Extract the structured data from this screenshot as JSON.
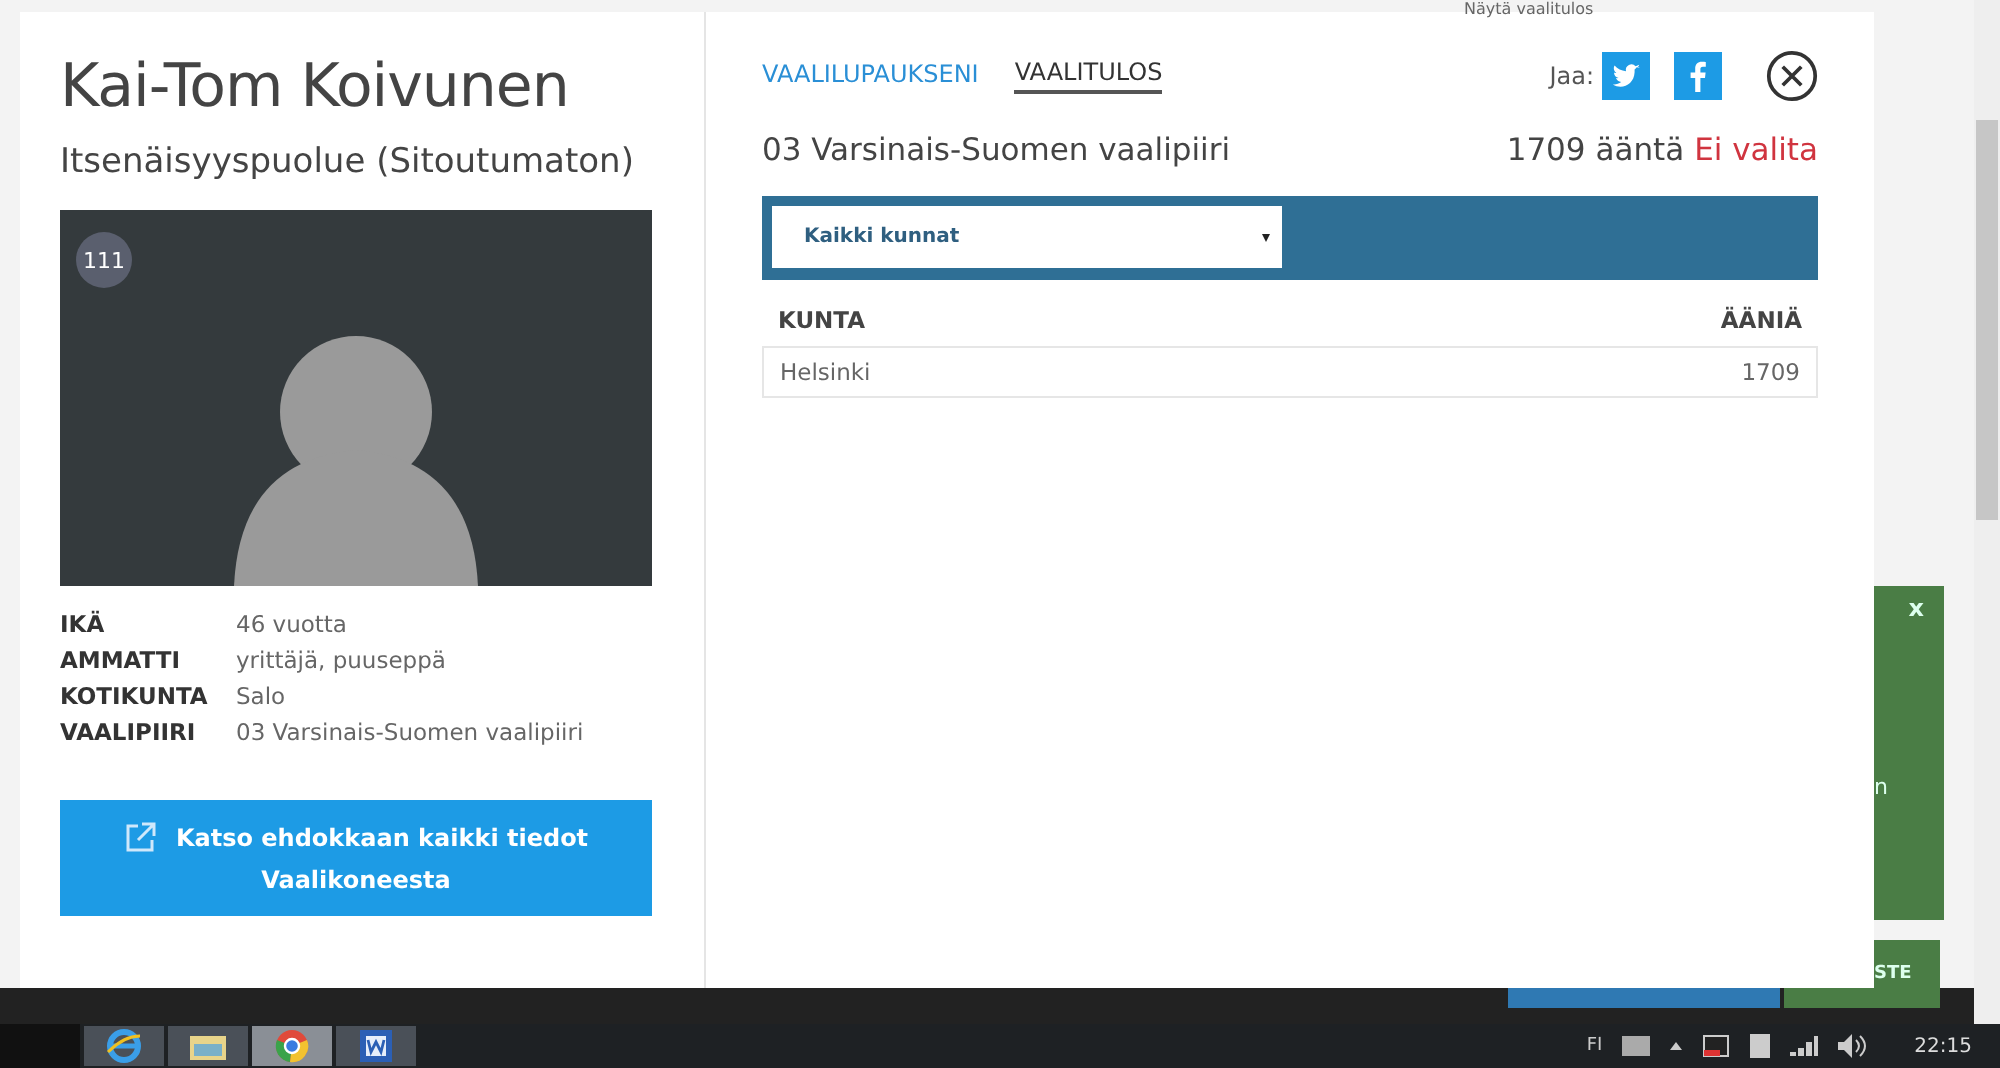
{
  "background_page": {
    "link_text": "Näytä vaalitulos",
    "panel_close": "x",
    "panel_text": "n",
    "panel_button": "STE"
  },
  "candidate": {
    "name": "Kai-Tom Koivunen",
    "party": "Itsenäisyyspuolue (Sitoutumaton)",
    "number": "111",
    "facts": [
      {
        "label": "IKÄ",
        "value": "46 vuotta"
      },
      {
        "label": "AMMATTI",
        "value": "yrittäjä, puuseppä"
      },
      {
        "label": "KOTIKUNTA",
        "value": "Salo"
      },
      {
        "label": "VAALIPIIRI",
        "value": "03 Varsinais-Suomen vaalipiiri"
      }
    ],
    "details_button": [
      "Katso ehdokkaan kaikki tiedot",
      "Vaalikoneesta"
    ]
  },
  "tabs": [
    {
      "label": "VAALILUPAUKSENI",
      "selected": false
    },
    {
      "label": "VAALITULOS",
      "selected": true
    }
  ],
  "share_label": "Jaa:",
  "result": {
    "district": "03 Varsinais-Suomen vaalipiiri",
    "votes": "1709 ääntä",
    "status": "Ei valita",
    "elected": false,
    "filter": {
      "value": "Kaikki kunnat"
    },
    "table": {
      "columns": [
        "KUNTA",
        "ÄÄNIÄ"
      ],
      "rows": [
        [
          "Helsinki",
          "1709"
        ]
      ]
    }
  },
  "taskbar": {
    "apps": [
      {
        "kind": "ie",
        "selected": false
      },
      {
        "kind": "folder",
        "selected": false
      },
      {
        "kind": "chrome",
        "selected": true
      },
      {
        "kind": "word",
        "selected": false
      }
    ],
    "language": "FI",
    "clock": "22:15"
  }
}
